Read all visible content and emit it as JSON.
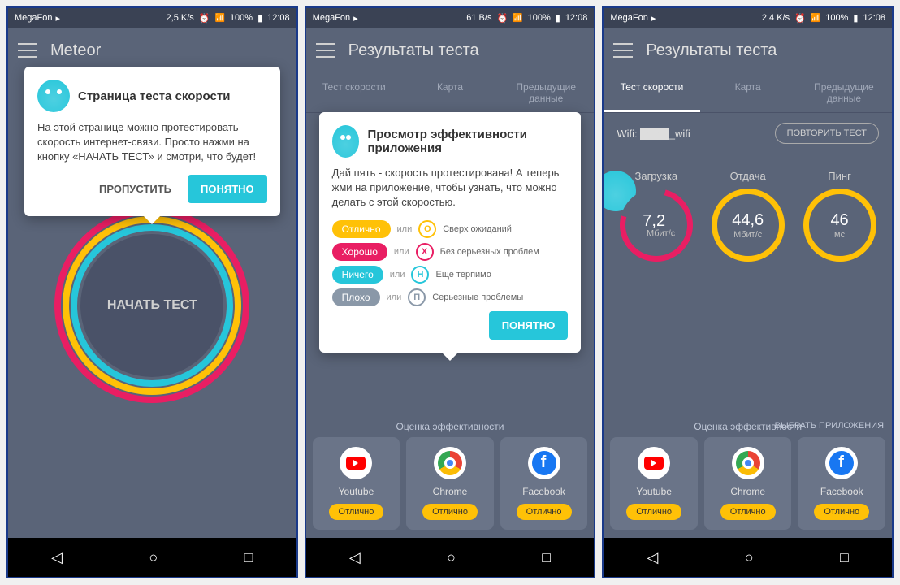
{
  "status": {
    "carrier": "MegaFon",
    "speeds": [
      "2,5 K/s",
      "61 B/s",
      "2,4 K/s"
    ],
    "battery": "100%",
    "time": "12:08"
  },
  "screen1": {
    "title": "Meteor",
    "tooltip": {
      "title": "Страница теста скорости",
      "body": "На этой странице можно протестировать скорость интернет-связи. Просто нажми на кнопку «НАЧАТЬ ТЕСТ» и смотри, что будет!",
      "skip": "ПРОПУСТИТЬ",
      "ok": "ПОНЯТНО"
    },
    "start": "НАЧАТЬ ТЕСТ"
  },
  "screen2": {
    "title": "Результаты теста",
    "tabs": [
      "Тест скорости",
      "Карта",
      "Предыдущие данные"
    ],
    "tooltip": {
      "title": "Просмотр эффективности приложения",
      "body": "Дай пять - скорость протестирована! А теперь жми на приложение, чтобы узнать, что можно делать с этой скоростью.",
      "ok": "ПОНЯТНО"
    },
    "legend": [
      {
        "label": "Отлично",
        "abbr": "О",
        "desc": "Сверх ожиданий",
        "cls": "y"
      },
      {
        "label": "Хорошо",
        "abbr": "Х",
        "desc": "Без серьезных проблем",
        "cls": "p"
      },
      {
        "label": "Ничего",
        "abbr": "Н",
        "desc": "Еще терпимо",
        "cls": "c"
      },
      {
        "label": "Плохо",
        "abbr": "П",
        "desc": "Серьезные проблемы",
        "cls": "g"
      }
    ],
    "or": "или",
    "section": "Оценка эффективности"
  },
  "screen3": {
    "title": "Результаты теста",
    "wifi_label": "Wifi:",
    "wifi_name": "_wifi",
    "retry": "ПОВТОРИТЬ ТЕСТ",
    "metrics": [
      {
        "label": "Загрузка",
        "value": "7,2",
        "unit": "Мбит/с",
        "cls": "pink"
      },
      {
        "label": "Отдача",
        "value": "44,6",
        "unit": "Мбит/с",
        "cls": "yellow"
      },
      {
        "label": "Пинг",
        "value": "46",
        "unit": "мс",
        "cls": "yellow"
      }
    ],
    "select_apps": "ВЫБРАТЬ ПРИЛОЖЕНИЯ",
    "section": "Оценка эффективности"
  },
  "apps": [
    {
      "name": "Youtube",
      "rating": "Отлично",
      "icon": "yt"
    },
    {
      "name": "Chrome",
      "rating": "Отлично",
      "icon": "chrome"
    },
    {
      "name": "Facebook",
      "rating": "Отлично",
      "icon": "fb"
    }
  ]
}
